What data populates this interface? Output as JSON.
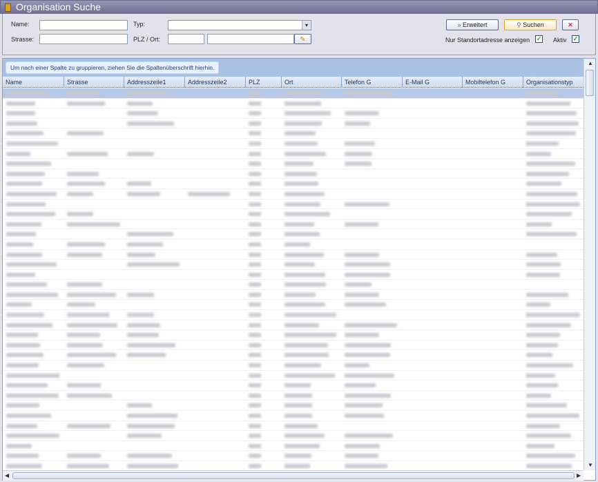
{
  "window": {
    "title": "Organisation Suche",
    "icon": "organisation-icon"
  },
  "filter": {
    "name_label": "Name:",
    "name_value": "",
    "strasse_label": "Strasse:",
    "strasse_value": "",
    "typ_label": "Typ:",
    "typ_value": "",
    "plz_ort_label": "PLZ / Ort:",
    "plz_value": "",
    "ort_value": "",
    "erweitert_label": "Erweitert",
    "suchen_label": "Suchen",
    "nur_standort_label": "Nur Standortadresse anzeigen",
    "nur_standort_checked": true,
    "aktiv_label": "Aktiv",
    "aktiv_checked": true
  },
  "grid": {
    "group_hint": "Um nach einer Spalte zu gruppieren, ziehen Sie die Spaltenüberschrift hierhin.",
    "columns": [
      "Name",
      "Strasse",
      "Addresszeile1",
      "Addresszeile2",
      "PLZ",
      "Ort",
      "Telefon G",
      "E-Mail G",
      "Mobiltelefon G",
      "Organisationstyp"
    ],
    "selected_row": 0,
    "row_count_visible": 38
  },
  "colors": {
    "accent": "#a9c1e2",
    "title": "#716f93",
    "selection": "#b7c9e6"
  }
}
